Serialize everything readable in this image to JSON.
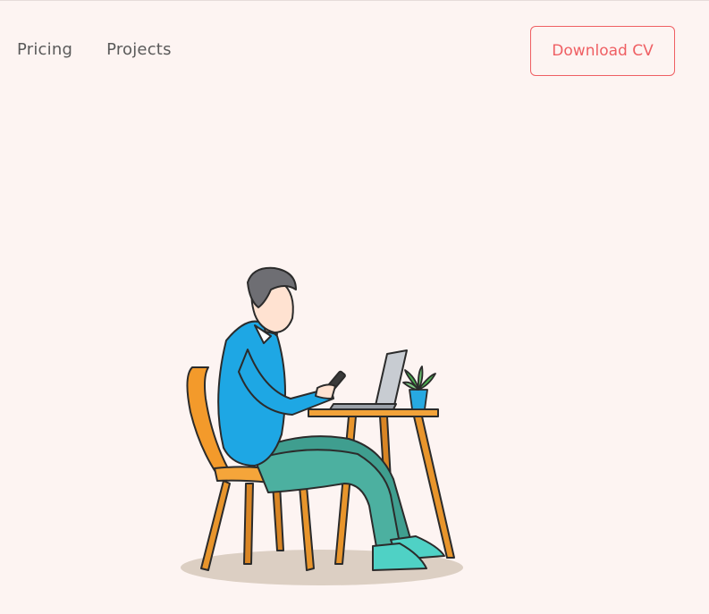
{
  "nav": {
    "items": [
      {
        "label": "Pricing"
      },
      {
        "label": "Projects"
      }
    ]
  },
  "header": {
    "cta_label": "Download CV"
  },
  "hero": {
    "illustration": "man-sitting-at-desk-with-phone-and-laptop-illustration"
  },
  "colors": {
    "background": "#fdf4f2",
    "accent": "#ef5f63",
    "nav_text": "#5a5a5a"
  }
}
